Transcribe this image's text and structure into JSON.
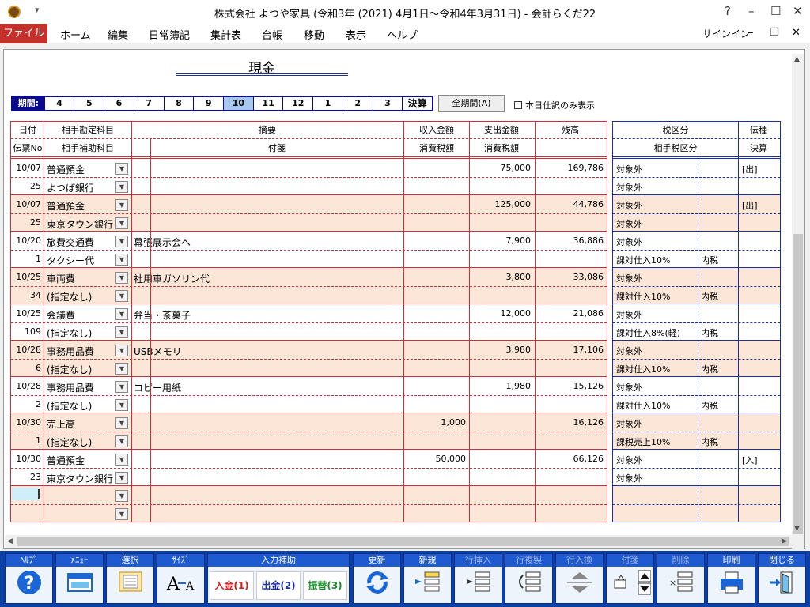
{
  "window": {
    "title": "株式会社 よつや家具 (令和3年 (2021) 4月1日～令和4年3月31日) - 会計らくだ22",
    "help_icon": "?",
    "quick_access": "▾"
  },
  "menu": {
    "items": [
      "ファイル",
      "ホーム",
      "編集",
      "日常簿記",
      "集計表",
      "台帳",
      "移動",
      "表示",
      "ヘルプ"
    ],
    "signin": "サインイン"
  },
  "page": {
    "title": "現金"
  },
  "period": {
    "label": "期間:",
    "months": [
      "4",
      "5",
      "6",
      "7",
      "8",
      "9",
      "10",
      "11",
      "12",
      "1",
      "2",
      "3"
    ],
    "selected": "10",
    "settlement": "決算",
    "all_button": "全期間(A)",
    "today_only": "本日仕訳のみ表示"
  },
  "headers": {
    "date": "日付",
    "slip_no": "伝票No",
    "account": "相手勘定科目",
    "sub_account": "相手補助科目",
    "summary": "摘要",
    "note": "付箋",
    "income": "収入金額",
    "expense": "支出金額",
    "income_tax": "消費税額",
    "expense_tax": "消費税額",
    "balance": "残高",
    "tax_class": "税区分",
    "partner_tax_class": "相手税区分",
    "slip_type": "伝種",
    "settle": "決算"
  },
  "entries": [
    {
      "date": "10/07",
      "no": "25",
      "account": "普通預金",
      "sub": "よつば銀行",
      "summary": "",
      "income": "",
      "expense": "75,000",
      "balance": "169,786",
      "tax": "対象外",
      "tax2": "対象外",
      "tax_in": "",
      "slip": "[出]",
      "shade": false
    },
    {
      "date": "10/07",
      "no": "25",
      "account": "普通預金",
      "sub": "東京タウン銀行",
      "summary": "",
      "income": "",
      "expense": "125,000",
      "balance": "44,786",
      "tax": "対象外",
      "tax2": "対象外",
      "tax_in": "",
      "slip": "[出]",
      "shade": true
    },
    {
      "date": "10/20",
      "no": "1",
      "account": "旅費交通費",
      "sub": "タクシー代",
      "summary": "幕張展示会へ",
      "income": "",
      "expense": "7,900",
      "balance": "36,886",
      "tax": "対象外",
      "tax2": "課対仕入10%",
      "tax_in": "内税",
      "slip": "",
      "shade": false
    },
    {
      "date": "10/25",
      "no": "34",
      "account": "車両費",
      "sub": "(指定なし)",
      "summary": "社用車ガソリン代",
      "income": "",
      "expense": "3,800",
      "balance": "33,086",
      "tax": "対象外",
      "tax2": "課対仕入10%",
      "tax_in": "内税",
      "slip": "",
      "shade": true
    },
    {
      "date": "10/25",
      "no": "109",
      "account": "会議費",
      "sub": "(指定なし)",
      "summary": "弁当・茶菓子",
      "income": "",
      "expense": "12,000",
      "balance": "21,086",
      "tax": "対象外",
      "tax2": "課対仕入8%(軽)",
      "tax_in": "内税",
      "slip": "",
      "shade": false
    },
    {
      "date": "10/28",
      "no": "6",
      "account": "事務用品費",
      "sub": "(指定なし)",
      "summary": "USBメモリ",
      "income": "",
      "expense": "3,980",
      "balance": "17,106",
      "tax": "対象外",
      "tax2": "課対仕入10%",
      "tax_in": "内税",
      "slip": "",
      "shade": true
    },
    {
      "date": "10/28",
      "no": "2",
      "account": "事務用品費",
      "sub": "(指定なし)",
      "summary": "コピー用紙",
      "income": "",
      "expense": "1,980",
      "balance": "15,126",
      "tax": "対象外",
      "tax2": "課対仕入10%",
      "tax_in": "内税",
      "slip": "",
      "shade": false
    },
    {
      "date": "10/30",
      "no": "1",
      "account": "売上高",
      "sub": "(指定なし)",
      "summary": "",
      "income": "1,000",
      "expense": "",
      "balance": "16,126",
      "tax": "対象外",
      "tax2": "課税売上10%",
      "tax_in": "内税",
      "slip": "",
      "shade": true
    },
    {
      "date": "10/30",
      "no": "23",
      "account": "普通預金",
      "sub": "東京タウン銀行",
      "summary": "",
      "income": "50,000",
      "expense": "",
      "balance": "66,126",
      "tax": "対象外",
      "tax2": "対象外",
      "tax_in": "",
      "slip": "[入]",
      "shade": false
    }
  ],
  "toolbar": {
    "help": "ﾍﾙﾌﾟ",
    "menu": "ﾒﾆｭｰ",
    "select": "選択",
    "size": "ｻｲｽﾞ",
    "input_assist": "入力補助",
    "nyukin": "入金(1)",
    "shukkin": "出金(2)",
    "furikae": "振替(3)",
    "refresh": "更新",
    "new": "新規",
    "insert_row": "行挿入",
    "copy_row": "行複製",
    "swap_row": "行入換",
    "sticky": "付箋",
    "delete": "削除",
    "print": "印刷",
    "close": "閉じる"
  },
  "colors": {
    "menu_file_bg": "#c4312b",
    "shaded_row": "#fbe6d8",
    "grid_red": "#c8303a",
    "grid_blue": "#1a2fa0",
    "toolbar_bg": "#0a3fa5"
  }
}
